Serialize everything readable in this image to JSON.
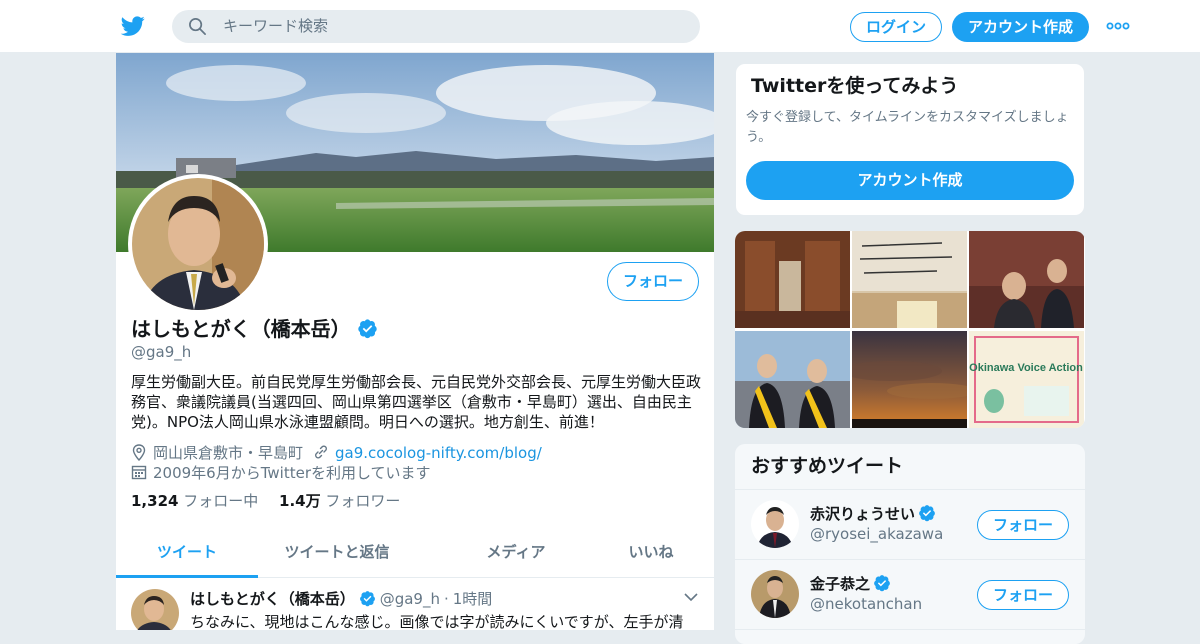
{
  "colors": {
    "accent": "#1da1f2",
    "link": "#1b95e0",
    "muted": "#657786",
    "background": "#e6ecf0"
  },
  "header": {
    "logo_icon": "twitter-bird-icon",
    "search_placeholder": "キーワード検索",
    "login_label": "ログイン",
    "signup_label": "アカウント作成",
    "more_icon": "more-dots-icon"
  },
  "profile": {
    "name": "はしもとがく（橋本岳）",
    "handle": "@ga9_h",
    "follow_label": "フォロー",
    "bio": "厚生労働副大臣。前自民党厚生労働部会長、元自民党外交部会長、元厚生労働大臣政務官、衆議院議員(当選四回、岡山県第四選挙区（倉敷市・早島町）選出、自由民主党)。NPO法人岡山県水泳連盟顧問。明日への選択。地方創生、前進！",
    "location": "岡山県倉敷市・早島町",
    "url": "ga9.cocolog-nifty.com/blog/",
    "joined": "2009年6月からTwitterを利用しています",
    "following_count": "1,324",
    "following_label": "フォロー中",
    "followers_count": "1.4万",
    "followers_label": "フォロワー"
  },
  "tabs": [
    {
      "label": "ツイート",
      "active": true
    },
    {
      "label": "ツイートと返信",
      "active": false
    },
    {
      "label": "メディア",
      "active": false
    },
    {
      "label": "いいね",
      "active": false
    }
  ],
  "tweet": {
    "name": "はしもとがく（橋本岳）",
    "handle": "@ga9_h",
    "sep": "·",
    "time": "1時間",
    "text": "ちなみに、現地はこんな感じ。画像では字が読みにくいですが、左手が清"
  },
  "sidebar": {
    "try_title": "Twitterを使ってみよう",
    "try_desc": "今すぐ登録して、タイムラインをカスタマイズしましょう。",
    "try_button": "アカウント作成",
    "media_tile5_text": "Okinawa Voice Action",
    "reco_title": "おすすめツイート",
    "reco": [
      {
        "name": "赤沢りょうせい",
        "handle": "@ryosei_akazawa",
        "follow_label": "フォロー"
      },
      {
        "name": "金子恭之",
        "handle": "@nekotanchan",
        "follow_label": "フォロー"
      }
    ]
  }
}
